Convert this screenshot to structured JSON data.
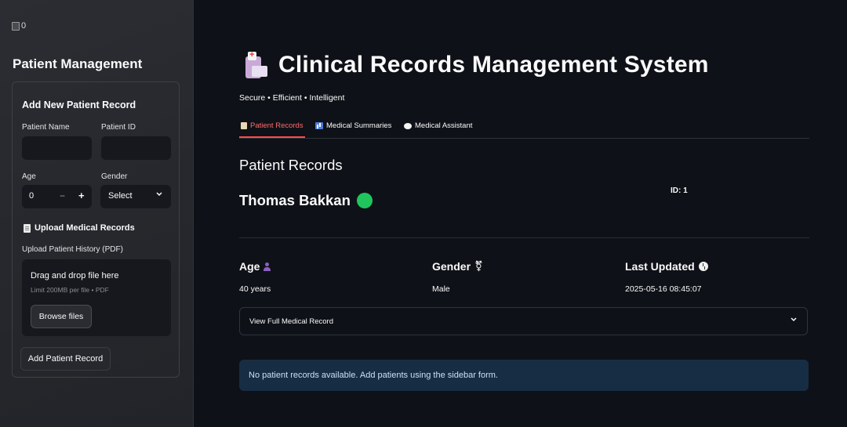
{
  "sidebar": {
    "logo_alt": "0",
    "title": "Patient Management",
    "form": {
      "heading": "Add New Patient Record",
      "patient_name_label": "Patient Name",
      "patient_id_label": "Patient ID",
      "age_label": "Age",
      "age_value": "0",
      "minus": "−",
      "plus": "+",
      "gender_label": "Gender",
      "gender_value": "Select",
      "upload_heading": "Upload Medical Records",
      "upload_label": "Upload Patient History (PDF)",
      "dropzone_text": "Drag and drop file here",
      "dropzone_limit": "Limit 200MB per file • PDF",
      "browse_label": "Browse files",
      "add_button": "Add Patient Record"
    }
  },
  "main": {
    "title": "Clinical Records Management System",
    "subtitle": "Secure • Efficient • Intelligent",
    "tabs": [
      {
        "label": "Patient Records",
        "icon": "clipboard-icon",
        "active": true
      },
      {
        "label": "Medical Summaries",
        "icon": "bar-chart-icon",
        "active": false
      },
      {
        "label": "Medical Assistant",
        "icon": "speech-bubble-icon",
        "active": false
      }
    ],
    "section_title": "Patient Records",
    "patient": {
      "name": "Thomas Bakkan",
      "id_text": "ID: 1",
      "status_color": "#21c55d",
      "age_head": "Age",
      "age_value": "40 years",
      "gender_head": "Gender",
      "gender_value": "Male",
      "updated_head": "Last Updated",
      "updated_value": "2025-05-16 08:45:07"
    },
    "expander_label": "View Full Medical Record",
    "info_message": "No patient records available. Add patients using the sidebar form."
  },
  "colors": {
    "background": "#0e1117",
    "sidebar": "#26282d",
    "accent": "#ff4b4b",
    "info_bg": "#172d43"
  }
}
